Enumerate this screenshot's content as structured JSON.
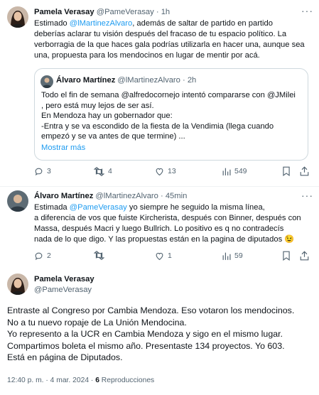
{
  "tweet1": {
    "name": "Pamela Verasay",
    "handle": "@PameVerasay",
    "sep": "·",
    "time": "1h",
    "text_1": "Estimado ",
    "mention": "@lMartinezAlvaro",
    "text_2": ", además de saltar de partido en partido\ndeberías aclarar tu visión después del fracaso de tu espacio político. La\nverborragia de la que haces gala podrías utilizarla en hacer una, aunque sea\nuna,  propuesta para los mendocinos en lugar de mentir por acá.",
    "quote": {
      "name": "Álvaro Martínez",
      "handle": "@lMartinezAlvaro",
      "sep": "·",
      "time": "2h",
      "text": "Todo el fin de semana @alfredocornejo intentó compararse con @JMilei\n, pero está muy lejos de ser así.\nEn Mendoza hay un gobernador que:\n-Entra y se va escondido de la fiesta de la Vendimia (llega cuando\nempezó y se va antes de que termine) ...",
      "show_more": "Mostrar más"
    },
    "replies": "3",
    "retweets": "4",
    "likes": "13",
    "views": "549"
  },
  "tweet2": {
    "name": "Álvaro Martínez",
    "handle": "@lMartinezAlvaro",
    "sep": "·",
    "time": "45min",
    "text_1": "Estimada ",
    "mention": "@PameVerasay",
    "text_2": " yo siempre he seguido la misma línea,\na diferencia de vos que fuiste Kircherista, después con Binner, después con\nMassa, después Macri y luego Bullrich. Lo positivo es q no contradecís\nnada de lo que digo. Y las propuestas están en la pagina de diputados",
    "emoji": "😉",
    "replies": "2",
    "retweets": "",
    "likes": "1",
    "views": "59"
  },
  "tweet3": {
    "name": "Pamela Verasay",
    "handle": "@PameVerasay",
    "text": "Entraste al Congreso por Cambia Mendoza. Eso votaron los mendocinos.\nNo a tu nuevo ropaje de La Unión Mendocina.\nYo represento a la UCR en Cambia Mendoza y sigo en el mismo lugar.\nCompartimos boleta el mismo año. Presentaste 134 proyectos. Yo 603.\nEstá en página de Diputados.",
    "timestamp": "12:40 p. m. · 4 mar. 2024 · ",
    "views_count": "6",
    "views_label": " Reproducciones"
  },
  "icons": [
    "more-icon",
    "reply-icon",
    "retweet-icon",
    "like-icon",
    "views-icon",
    "bookmark-icon",
    "share-icon"
  ]
}
